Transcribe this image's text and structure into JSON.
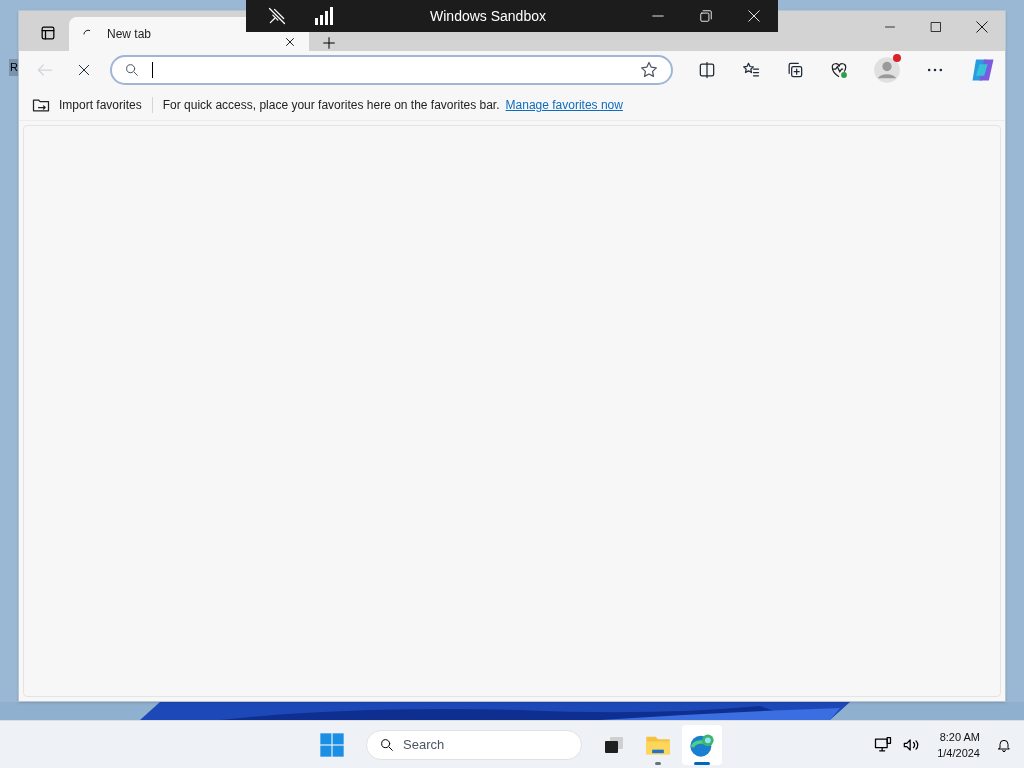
{
  "sandbox_bar": {
    "title": "Windows Sandbox"
  },
  "desktop": {
    "label": "R"
  },
  "browser": {
    "tabs": [
      {
        "title": "New tab",
        "selected": true,
        "loading": true
      }
    ],
    "back_disabled": true,
    "loading": true,
    "profile": {
      "notification": true
    },
    "favorites_bar": {
      "import_label": "Import favorites",
      "message": "For quick access, place your favorites here on the favorites bar.",
      "link": "Manage favorites now"
    }
  },
  "taskbar": {
    "search_placeholder": "Search",
    "apps": [
      {
        "kind": "task-view",
        "running": false,
        "selected": false
      },
      {
        "kind": "explorer",
        "running": true,
        "selected": false
      },
      {
        "kind": "edge",
        "running": true,
        "selected": true
      }
    ],
    "clock": {
      "time": "8:20 AM",
      "date": "1/4/2024"
    }
  }
}
